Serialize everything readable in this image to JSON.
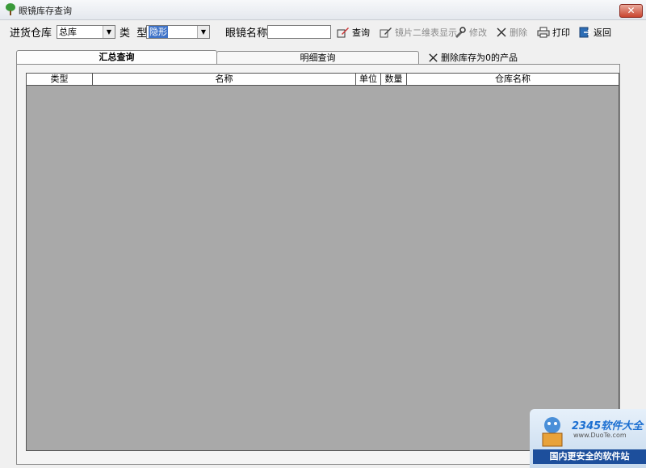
{
  "window": {
    "title": "眼镜库存查询",
    "close_symbol": "✕"
  },
  "filters": {
    "warehouse_label": "进货仓库",
    "warehouse_value": "总库",
    "type_label": "类  型",
    "type_value": "隐形",
    "name_label": "眼镜名称",
    "name_value": ""
  },
  "toolbar": {
    "query": "查询",
    "lens_grid": "镜片二维表显示",
    "modify": "修改",
    "delete": "删除",
    "print": "打印",
    "back": "返回"
  },
  "tabs": {
    "summary": "汇总查询",
    "detail": "明细查询",
    "delete_zero": "删除库存为0的产品"
  },
  "table": {
    "columns": [
      "类型",
      "名称",
      "单位",
      "数量",
      "仓库名称"
    ]
  },
  "watermark": {
    "logo": "2345软件大全",
    "url": "www.DuoTe.com",
    "slogan": "国内更安全的软件站"
  }
}
